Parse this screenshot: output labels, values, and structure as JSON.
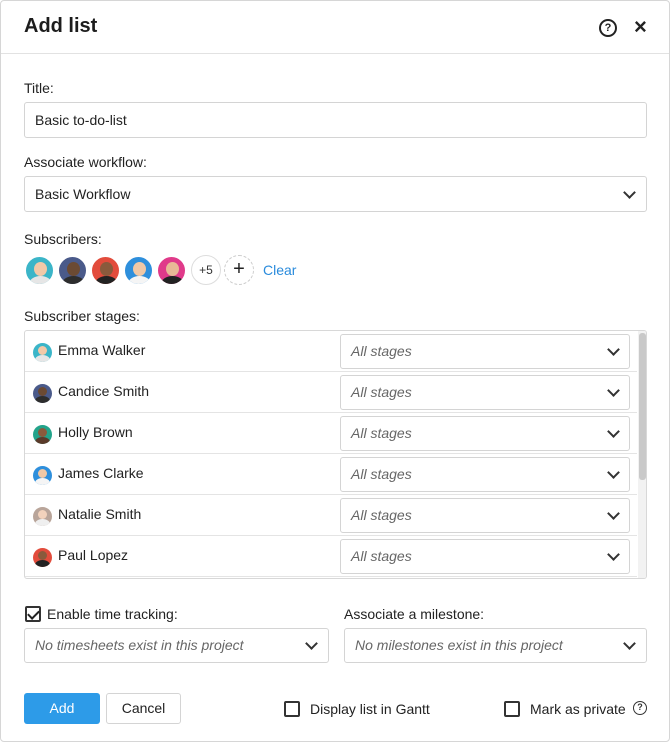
{
  "dialog": {
    "title": "Add list"
  },
  "form": {
    "title_label": "Title:",
    "title_value": "Basic to-do-list",
    "workflow_label": "Associate workflow:",
    "workflow_value": "Basic Workflow",
    "subscribers_label": "Subscribers:",
    "subscribers_more": "+5",
    "add_subscriber_symbol": "+",
    "clear_label": "Clear",
    "stages_label": "Subscriber stages:",
    "stages": [
      {
        "name": "Emma Walker",
        "stage": "All stages"
      },
      {
        "name": "Candice Smith",
        "stage": "All stages"
      },
      {
        "name": "Holly Brown",
        "stage": "All stages"
      },
      {
        "name": "James Clarke",
        "stage": "All stages"
      },
      {
        "name": "Natalie Smith",
        "stage": "All stages"
      },
      {
        "name": "Paul Lopez",
        "stage": "All stages"
      }
    ],
    "time_tracking_label": "Enable time tracking:",
    "time_tracking_checked": true,
    "timesheets_placeholder": "No timesheets exist in this project",
    "milestone_label": "Associate a milestone:",
    "milestone_placeholder": "No milestones exist in this project"
  },
  "footer": {
    "add_label": "Add",
    "cancel_label": "Cancel",
    "gantt_label": "Display list in Gantt",
    "private_label": "Mark as private"
  },
  "icons": {
    "help": "help-circle-icon",
    "close": "close-icon",
    "chevron": "chevron-down-icon",
    "check": "checkmark-icon"
  },
  "colors": {
    "accent": "#2d9be8",
    "link": "#2a8bdc"
  }
}
